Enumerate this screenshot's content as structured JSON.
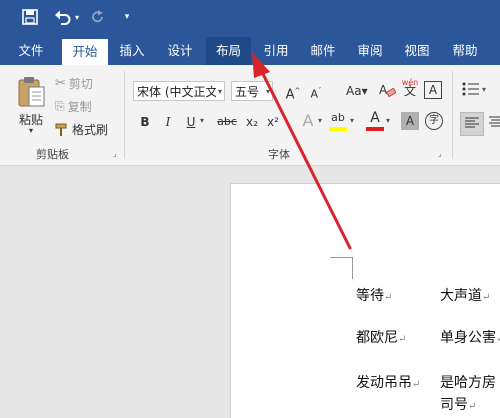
{
  "quick_access": {
    "save_icon": "save-icon",
    "undo_icon": "undo-icon",
    "redo_icon": "redo-icon",
    "customize_icon": "customize-qat-icon"
  },
  "tabs": [
    "文件",
    "开始",
    "插入",
    "设计",
    "布局",
    "引用",
    "邮件",
    "审阅",
    "视图",
    "帮助"
  ],
  "clipboard": {
    "paste_label": "粘贴",
    "cut_label": "剪切",
    "copy_label": "复制",
    "format_painter_label": "格式刷",
    "group_label": "剪贴板"
  },
  "font": {
    "font_name": "宋体 (中文正文)",
    "font_size": "五号",
    "group_label": "字体",
    "pinyin_top": "wén",
    "pinyin_bottom": "文",
    "char_border": "A",
    "bold": "B",
    "italic": "I",
    "underline": "U",
    "strike": "abc",
    "subscript": "x₂",
    "superscript": "x²",
    "highlight": "ab",
    "font_color": "A",
    "shading": "A",
    "enclose": "字"
  },
  "document": {
    "rows": [
      [
        "等待",
        "大声道"
      ],
      [
        "都欧尼",
        "单身公害"
      ],
      [
        "发动吊吊",
        "是哈方房"
      ],
      [
        "",
        "司号"
      ]
    ]
  },
  "colors": {
    "brand": "#2b579a",
    "arrow": "#d9232a",
    "highlight_yellow": "#ffff00",
    "font_red": "#e02020"
  }
}
